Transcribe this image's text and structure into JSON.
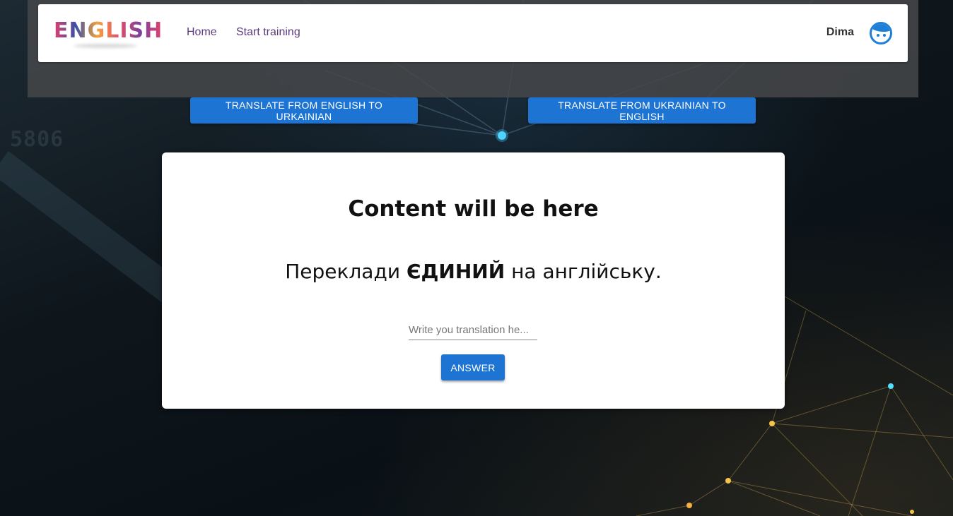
{
  "brand": {
    "logo_text": "ENGLISH"
  },
  "nav": {
    "items": [
      {
        "label": "Home"
      },
      {
        "label": "Start training"
      }
    ]
  },
  "user": {
    "name": "Dima",
    "avatar_icon": "user-avatar-icon"
  },
  "background": {
    "number": "5806"
  },
  "modes": {
    "en_to_ua": "TRANSLATE FROM ENGLISH TO URKAINIAN",
    "ua_to_en": "TRANSLATE FROM UKRAINIAN TO ENGLISH"
  },
  "card": {
    "title": "Content will be here",
    "prompt_before": "Переклади ",
    "prompt_word": "ЄДИНИЙ",
    "prompt_after": " на англійську.",
    "input_placeholder": "Write you translation he...",
    "input_value": "",
    "answer_label": "ANSWER"
  },
  "colors": {
    "primary": "#1e74d2",
    "nav_link": "#5c3a7e",
    "header_band": "#46484a"
  }
}
